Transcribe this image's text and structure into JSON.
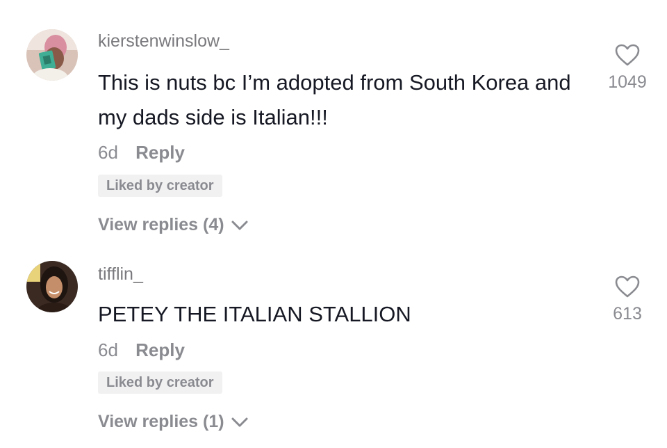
{
  "comments": [
    {
      "username": "kierstenwinslow_",
      "text": "This is nuts bc I’m adopted from South Korea and my dads side is Italian!!!",
      "time": "6d",
      "reply_label": "Reply",
      "badge": "Liked by creator",
      "view_replies": "View replies (4)",
      "likes": "1049",
      "avatar_colors": {
        "bg": "#c9a89a",
        "accent": "#3fae94"
      }
    },
    {
      "username": "tifflin_",
      "text": "PETEY THE ITALIAN STALLION",
      "time": "6d",
      "reply_label": "Reply",
      "badge": "Liked by creator",
      "view_replies": "View replies (1)",
      "likes": "613",
      "avatar_colors": {
        "bg": "#2a1f1a",
        "accent": "#c48e6a"
      }
    }
  ],
  "icons": {
    "like": "heart-outline-icon",
    "expand": "chevron-down-icon"
  },
  "colors": {
    "primary_text": "#161823",
    "secondary_text": "#8a8b91",
    "badge_bg": "#f1f1f2"
  }
}
